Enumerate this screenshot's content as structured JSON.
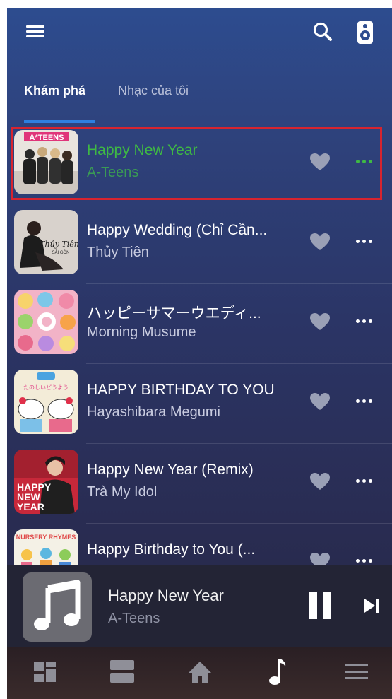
{
  "tabs": [
    {
      "label": "Khám phá"
    },
    {
      "label": "Nhạc của tôi"
    }
  ],
  "songs": [
    {
      "title": "Happy New Year",
      "artist": "A-Teens"
    },
    {
      "title": "Happy Wedding (Chỉ Cần...",
      "artist": "Thủy Tiên"
    },
    {
      "title": "ハッピーサマーウエディ...",
      "artist": "Morning Musume"
    },
    {
      "title": "HAPPY BIRTHDAY TO YOU",
      "artist": "Hayashibara Megumi"
    },
    {
      "title": "Happy New Year (Remix)",
      "artist": "Trà My Idol"
    },
    {
      "title": "Happy Birthday to You (...",
      "artist": ""
    }
  ],
  "artwork_text": {
    "a_teens": "A*TEENS",
    "thuy_tien": "Thủy Tiên",
    "thuy_tien_sub": "SÀI GÒN",
    "happy_big": "HAPPY",
    "new_big": "NEW",
    "year_big": "YEAR",
    "nursery": "NURSERY RHYMES",
    "tanoshii": "たのしいどうよう"
  },
  "now_playing": {
    "title": "Happy New Year",
    "artist": "A-Teens"
  },
  "colors": {
    "accent_green": "#3fb944",
    "tab_underline": "#2d7fe0",
    "highlight_red": "#d7242f"
  },
  "icons": [
    "menu-icon",
    "search-icon",
    "speaker-icon",
    "heart-icon",
    "more-icon",
    "music-note-icon",
    "pause-icon",
    "next-icon",
    "grid-icon",
    "list-icon",
    "home-icon",
    "music-icon",
    "menu-lines-icon"
  ]
}
